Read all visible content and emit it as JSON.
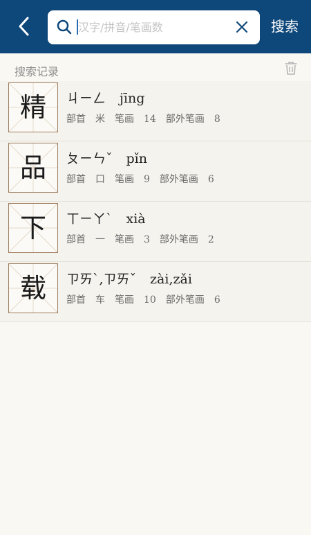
{
  "search": {
    "placeholder": "汉字/拼音/笔画数",
    "button_label": "搜索"
  },
  "history": {
    "title": "搜索记录",
    "items": [
      {
        "char": "精",
        "zhuyin": "ㄐㄧㄥ",
        "pinyin": "jīng",
        "radical_label": "部首",
        "radical": "米",
        "strokes_label": "笔画",
        "strokes": "14",
        "extra_label": "部外笔画",
        "extra": "8"
      },
      {
        "char": "品",
        "zhuyin": "ㄆㄧㄣˇ",
        "pinyin": "pǐn",
        "radical_label": "部首",
        "radical": "口",
        "strokes_label": "笔画",
        "strokes": "9",
        "extra_label": "部外笔画",
        "extra": "6"
      },
      {
        "char": "下",
        "zhuyin": "ㄒㄧㄚˋ",
        "pinyin": "xià",
        "radical_label": "部首",
        "radical": "一",
        "strokes_label": "笔画",
        "strokes": "3",
        "extra_label": "部外笔画",
        "extra": "2"
      },
      {
        "char": "载",
        "zhuyin": "ㄗㄞˋ,ㄗㄞˇ",
        "pinyin": "zài,zǎi",
        "radical_label": "部首",
        "radical": "车",
        "strokes_label": "笔画",
        "strokes": "10",
        "extra_label": "部外笔画",
        "extra": "6"
      }
    ]
  },
  "colors": {
    "header": "#0e477a",
    "background": "#faf8f3",
    "char_border": "#9c7b5e"
  }
}
